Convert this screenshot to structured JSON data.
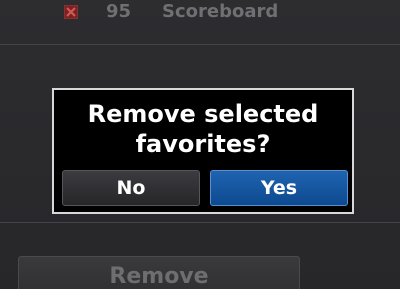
{
  "list": {
    "row": {
      "number": "95",
      "name": "Scoreboard",
      "checked": true
    }
  },
  "dialog": {
    "message_line1": "Remove selected",
    "message_line2": "favorites?",
    "no_label": "No",
    "yes_label": "Yes",
    "selected": "yes"
  },
  "footer": {
    "remove_label": "Remove"
  },
  "colors": {
    "background": "#2a2a2c",
    "dialog_border": "#d8d8dc",
    "selected_button": "#1558a4",
    "checkbox": "#7a2222",
    "dim_text": "#6f6f74"
  }
}
